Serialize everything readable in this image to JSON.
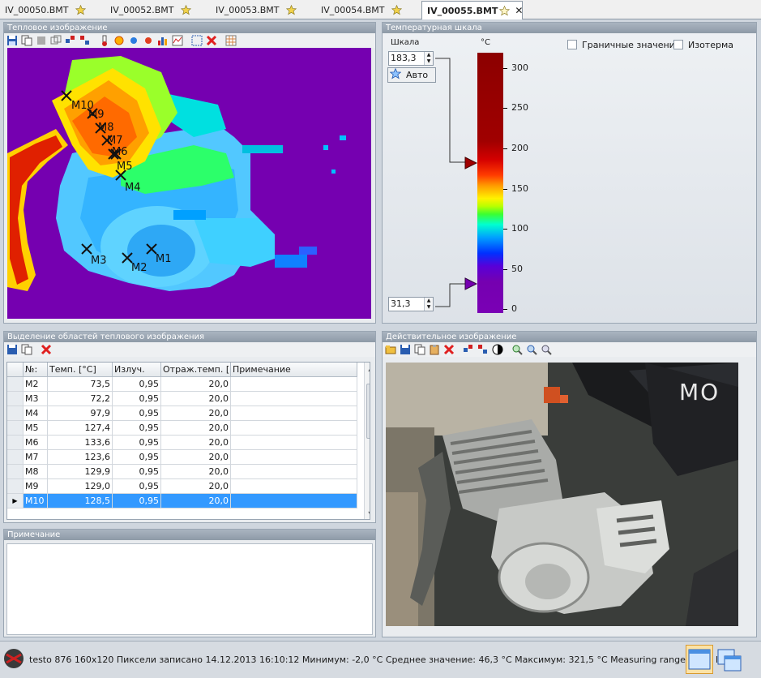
{
  "tabs": [
    {
      "label": "IV_00050.BMT",
      "active": false
    },
    {
      "label": "IV_00052.BMT",
      "active": false
    },
    {
      "label": "IV_00053.BMT",
      "active": false
    },
    {
      "label": "IV_00054.BMT",
      "active": false
    },
    {
      "label": "IV_00055.BMT",
      "active": true
    }
  ],
  "thermal_panel": {
    "title": "Тепловое изображение",
    "markers": [
      "M1",
      "M2",
      "M3",
      "M4",
      "M5",
      "M6",
      "M7",
      "M8",
      "M9",
      "M10"
    ]
  },
  "scale_panel": {
    "title": "Температурная шкала",
    "scale_label": "Шкала",
    "unit_label": "°C",
    "upper_value": "183,3",
    "lower_value": "31,3",
    "auto_label": "Авто",
    "boundary_label": "Граничные значения",
    "isotherm_label": "Изотерма",
    "ticks": [
      "300",
      "250",
      "200",
      "150",
      "100",
      "50",
      "0"
    ],
    "colors": {
      "max": "#8c0000",
      "min": "#7500b0"
    }
  },
  "regions_panel": {
    "title": "Выделение областей теплового изображения",
    "columns": [
      "№:",
      "Темп. [°C]",
      "Излуч.",
      "Отраж.темп. [°",
      "Примечание"
    ],
    "rows": [
      {
        "id": "M2",
        "temp": "73,5",
        "emis": "0,95",
        "refl": "20,0",
        "note": ""
      },
      {
        "id": "M3",
        "temp": "72,2",
        "emis": "0,95",
        "refl": "20,0",
        "note": ""
      },
      {
        "id": "M4",
        "temp": "97,9",
        "emis": "0,95",
        "refl": "20,0",
        "note": ""
      },
      {
        "id": "M5",
        "temp": "127,4",
        "emis": "0,95",
        "refl": "20,0",
        "note": ""
      },
      {
        "id": "M6",
        "temp": "133,6",
        "emis": "0,95",
        "refl": "20,0",
        "note": ""
      },
      {
        "id": "M7",
        "temp": "123,6",
        "emis": "0,95",
        "refl": "20,0",
        "note": ""
      },
      {
        "id": "M8",
        "temp": "129,9",
        "emis": "0,95",
        "refl": "20,0",
        "note": ""
      },
      {
        "id": "M9",
        "temp": "129,0",
        "emis": "0,95",
        "refl": "20,0",
        "note": ""
      },
      {
        "id": "M10",
        "temp": "128,5",
        "emis": "0,95",
        "refl": "20,0",
        "note": ""
      }
    ]
  },
  "note_panel": {
    "title": "Примечание"
  },
  "photo_panel": {
    "title": "Действительное изображение",
    "logo_text": "MO"
  },
  "status": {
    "text": "testo 876 160x120 Пиксели записано 14.12.2013 16:10:12 Минимум: -2,0 °C Среднее значение: 46,3 °C Максимум: 321,5 °C  Measuring range lower limi..."
  }
}
